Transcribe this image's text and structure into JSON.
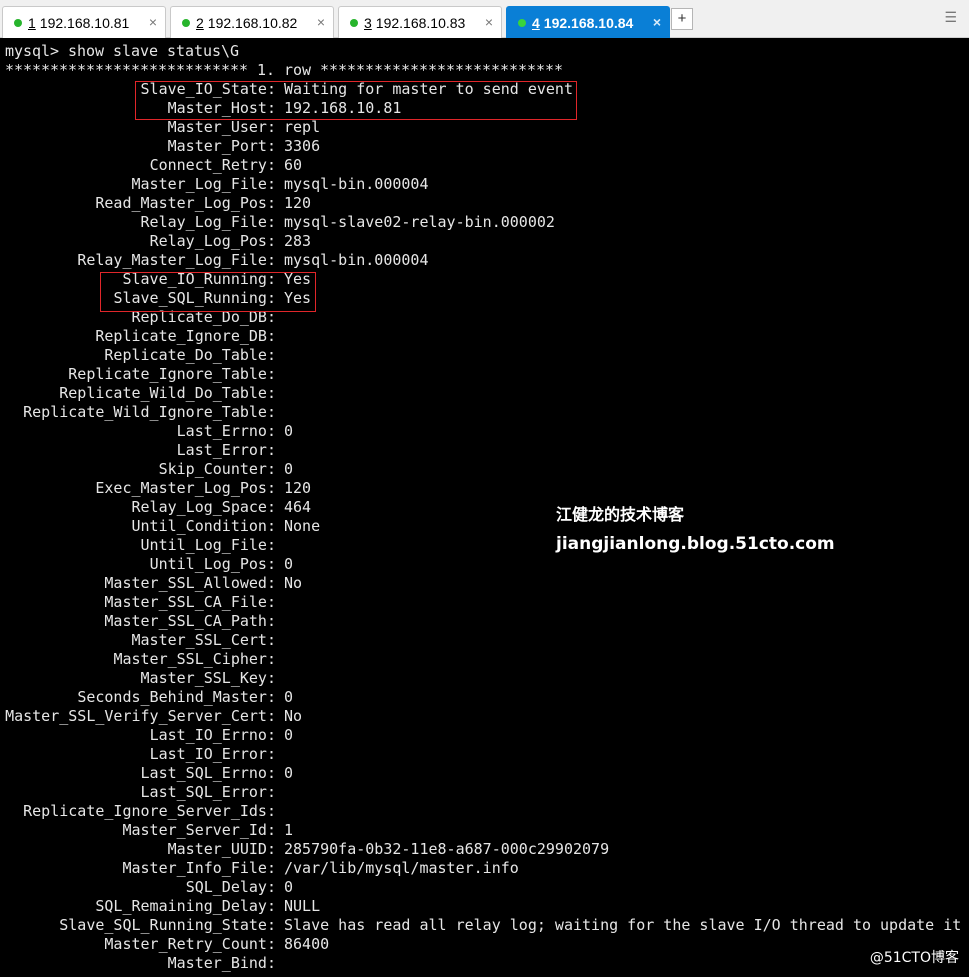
{
  "tabs": [
    {
      "num": "1",
      "host": "192.168.10.81",
      "active": false
    },
    {
      "num": "2",
      "host": "192.168.10.82",
      "active": false
    },
    {
      "num": "3",
      "host": "192.168.10.83",
      "active": false
    },
    {
      "num": "4",
      "host": "192.168.10.84",
      "active": true
    }
  ],
  "tab_close": "×",
  "tab_add": "+",
  "tab_menu": "☰",
  "terminal": {
    "command": "mysql> show slave status\\G",
    "row_header": "*************************** 1. row ***************************",
    "fields": [
      {
        "label": "Slave_IO_State",
        "value": "Waiting for master to send event"
      },
      {
        "label": "Master_Host",
        "value": "192.168.10.81"
      },
      {
        "label": "Master_User",
        "value": "repl"
      },
      {
        "label": "Master_Port",
        "value": "3306"
      },
      {
        "label": "Connect_Retry",
        "value": "60"
      },
      {
        "label": "Master_Log_File",
        "value": "mysql-bin.000004"
      },
      {
        "label": "Read_Master_Log_Pos",
        "value": "120"
      },
      {
        "label": "Relay_Log_File",
        "value": "mysql-slave02-relay-bin.000002"
      },
      {
        "label": "Relay_Log_Pos",
        "value": "283"
      },
      {
        "label": "Relay_Master_Log_File",
        "value": "mysql-bin.000004"
      },
      {
        "label": "Slave_IO_Running",
        "value": "Yes"
      },
      {
        "label": "Slave_SQL_Running",
        "value": "Yes"
      },
      {
        "label": "Replicate_Do_DB",
        "value": ""
      },
      {
        "label": "Replicate_Ignore_DB",
        "value": ""
      },
      {
        "label": "Replicate_Do_Table",
        "value": ""
      },
      {
        "label": "Replicate_Ignore_Table",
        "value": ""
      },
      {
        "label": "Replicate_Wild_Do_Table",
        "value": ""
      },
      {
        "label": "Replicate_Wild_Ignore_Table",
        "value": ""
      },
      {
        "label": "Last_Errno",
        "value": "0"
      },
      {
        "label": "Last_Error",
        "value": ""
      },
      {
        "label": "Skip_Counter",
        "value": "0"
      },
      {
        "label": "Exec_Master_Log_Pos",
        "value": "120"
      },
      {
        "label": "Relay_Log_Space",
        "value": "464"
      },
      {
        "label": "Until_Condition",
        "value": "None"
      },
      {
        "label": "Until_Log_File",
        "value": ""
      },
      {
        "label": "Until_Log_Pos",
        "value": "0"
      },
      {
        "label": "Master_SSL_Allowed",
        "value": "No"
      },
      {
        "label": "Master_SSL_CA_File",
        "value": ""
      },
      {
        "label": "Master_SSL_CA_Path",
        "value": ""
      },
      {
        "label": "Master_SSL_Cert",
        "value": ""
      },
      {
        "label": "Master_SSL_Cipher",
        "value": ""
      },
      {
        "label": "Master_SSL_Key",
        "value": ""
      },
      {
        "label": "Seconds_Behind_Master",
        "value": "0"
      },
      {
        "label": "Master_SSL_Verify_Server_Cert",
        "value": "No"
      },
      {
        "label": "Last_IO_Errno",
        "value": "0"
      },
      {
        "label": "Last_IO_Error",
        "value": ""
      },
      {
        "label": "Last_SQL_Errno",
        "value": "0"
      },
      {
        "label": "Last_SQL_Error",
        "value": ""
      },
      {
        "label": "Replicate_Ignore_Server_Ids",
        "value": ""
      },
      {
        "label": "Master_Server_Id",
        "value": "1"
      },
      {
        "label": "Master_UUID",
        "value": "285790fa-0b32-11e8-a687-000c29902079"
      },
      {
        "label": "Master_Info_File",
        "value": "/var/lib/mysql/master.info"
      },
      {
        "label": "SQL_Delay",
        "value": "0"
      },
      {
        "label": "SQL_Remaining_Delay",
        "value": "NULL"
      },
      {
        "label": "Slave_SQL_Running_State",
        "value": "Slave has read all relay log; waiting for the slave I/O thread to update it"
      },
      {
        "label": "Master_Retry_Count",
        "value": "86400"
      },
      {
        "label": "Master_Bind",
        "value": ""
      }
    ]
  },
  "watermark": {
    "title": "江健龙的技术博客",
    "url": "jiangjianlong.blog.51cto.com",
    "corner": "@51CTO博客"
  },
  "colors": {
    "terminal_bg": "#000000",
    "terminal_fg": "#e6e6e6",
    "active_tab": "#0a7fd6",
    "highlight_box": "#e0262a",
    "status_dot": "#27b42c"
  }
}
